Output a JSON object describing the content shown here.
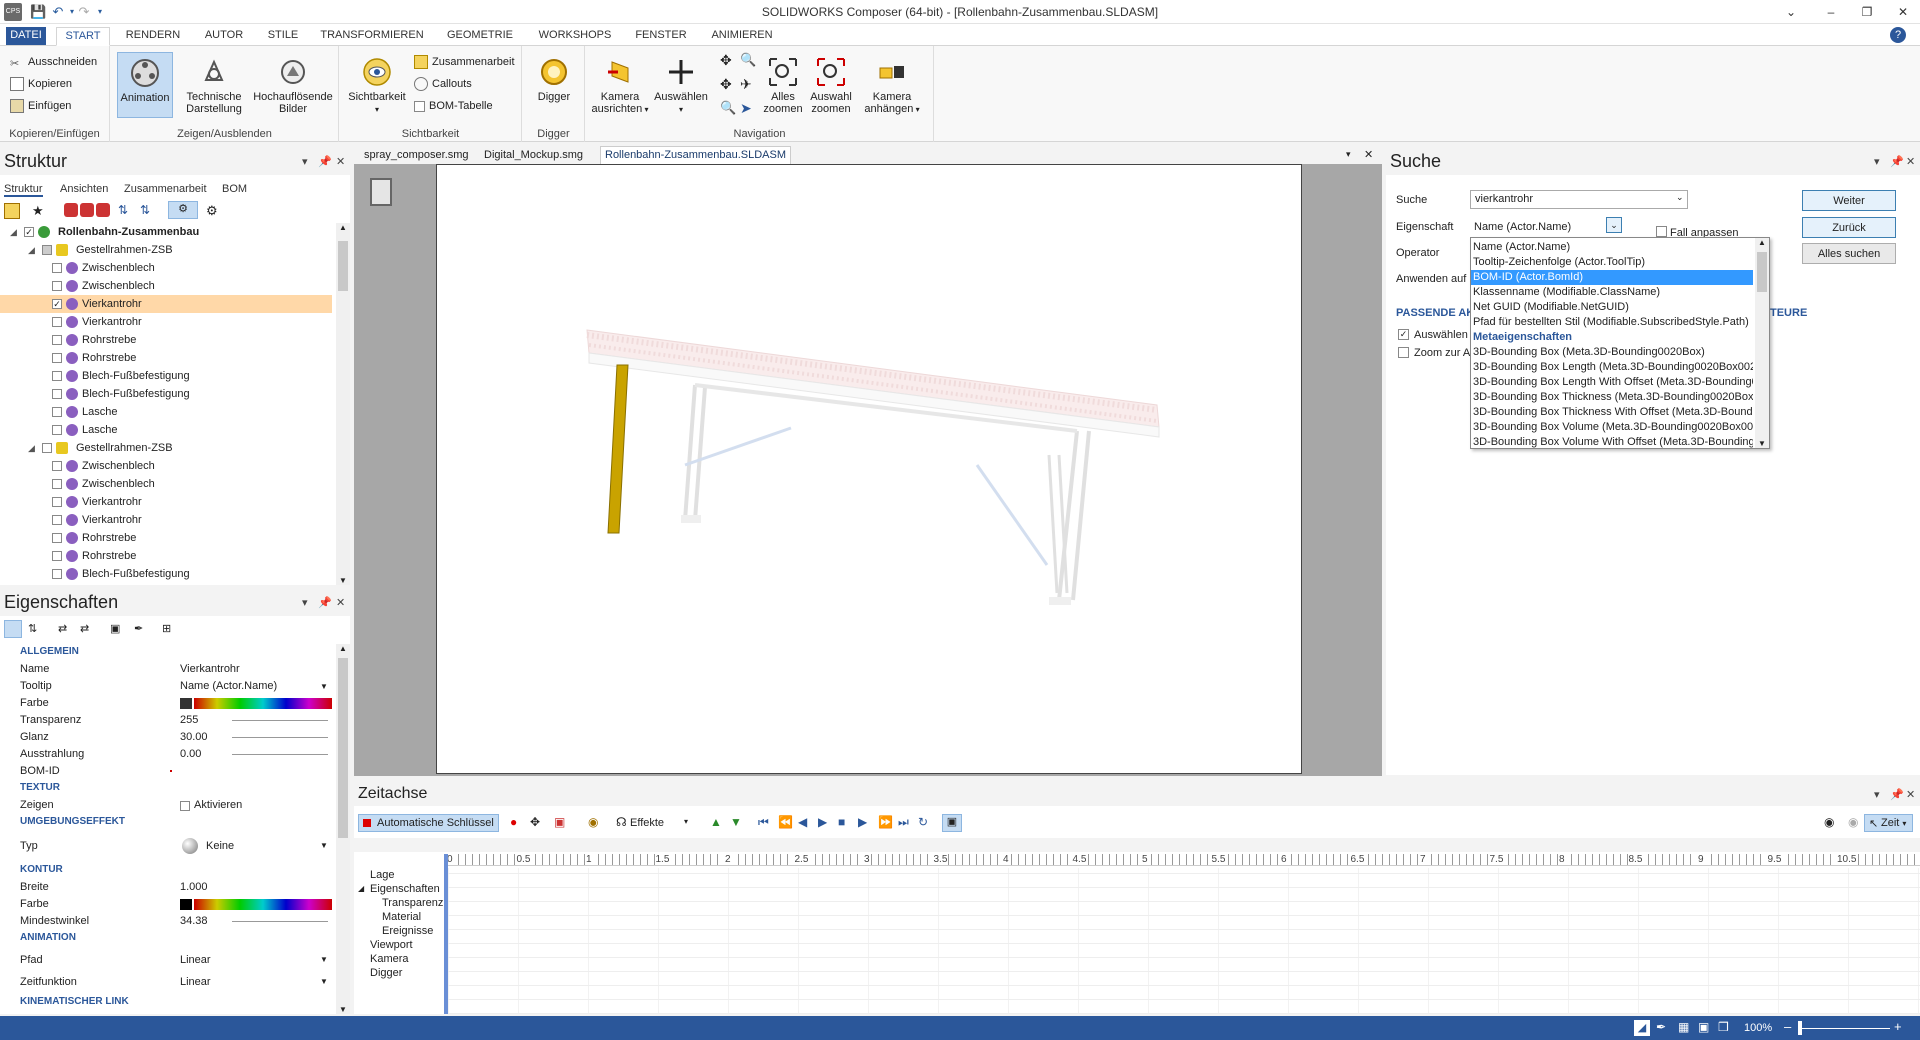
{
  "window": {
    "title": "SOLIDWORKS Composer (64-bit) - [Rollenbahn-Zusammenbau.SLDASM]"
  },
  "tabs": [
    "DATEI",
    "START",
    "RENDERN",
    "AUTOR",
    "STILE",
    "TRANSFORMIEREN",
    "GEOMETRIE",
    "WORKSHOPS",
    "FENSTER",
    "ANIMIEREN"
  ],
  "ribbon": {
    "clipboard": {
      "cut": "Ausschneiden",
      "copy": "Kopieren",
      "paste": "Einfügen",
      "group": "Kopieren/Einfügen"
    },
    "show": {
      "animation": "Animation",
      "technical_1": "Technische",
      "technical_2": "Darstellung",
      "hires_1": "Hochauflösende",
      "hires_2": "Bilder",
      "group": "Zeigen/Ausblenden"
    },
    "visibility": {
      "sichtbarkeit": "Sichtbarkeit",
      "zusammenarbeit": "Zusammenarbeit",
      "callouts": "Callouts",
      "bom": "BOM-Tabelle",
      "group": "Sichtbarkeit"
    },
    "digger": {
      "label": "Digger",
      "group": "Digger"
    },
    "navigation": {
      "camera_1": "Kamera",
      "camera_2": "ausrichten",
      "select": "Auswählen",
      "zoom_all_1": "Alles",
      "zoom_all_2": "zoomen",
      "zoom_sel_1": "Auswahl",
      "zoom_sel_2": "zoomen",
      "attach_1": "Kamera",
      "attach_2": "anhängen",
      "group": "Navigation"
    }
  },
  "structure": {
    "title": "Struktur",
    "subtabs": [
      "Struktur",
      "Ansichten",
      "Zusammenarbeit",
      "BOM"
    ],
    "root": "Rollenbahn-Zusammenbau",
    "group1": "Gestellrahmen-ZSB",
    "group1_items": [
      "Zwischenblech",
      "Zwischenblech",
      "Vierkantrohr",
      "Vierkantrohr",
      "Rohrstrebe",
      "Rohrstrebe",
      "Blech-Fußbefestigung",
      "Blech-Fußbefestigung",
      "Lasche",
      "Lasche"
    ],
    "group2": "Gestellrahmen-ZSB",
    "group2_items": [
      "Zwischenblech",
      "Zwischenblech",
      "Vierkantrohr",
      "Vierkantrohr",
      "Rohrstrebe",
      "Rohrstrebe",
      "Blech-Fußbefestigung"
    ]
  },
  "properties": {
    "title": "Eigenschaften",
    "sec_allgemein": "ALLGEMEIN",
    "name_label": "Name",
    "name_value": "Vierkantrohr",
    "tooltip_label": "Tooltip",
    "tooltip_value": "Name (Actor.Name)",
    "farbe_label": "Farbe",
    "transparenz_label": "Transparenz",
    "transparenz_value": "255",
    "glanz_label": "Glanz",
    "glanz_value": "30.00",
    "ausstrahlung_label": "Ausstrahlung",
    "ausstrahlung_value": "0.00",
    "bomid_label": "BOM-ID",
    "sec_textur": "TEXTUR",
    "zeigen_label": "Zeigen",
    "zeigen_value": "Aktivieren",
    "sec_umgebung": "UMGEBUNGSEFFEKT",
    "typ_label": "Typ",
    "typ_value": "Keine",
    "sec_kontur": "KONTUR",
    "breite_label": "Breite",
    "breite_value": "1.000",
    "farbe2_label": "Farbe",
    "mindest_label": "Mindestwinkel",
    "mindest_value": "34.38",
    "sec_animation": "ANIMATION",
    "pfad_label": "Pfad",
    "pfad_value": "Linear",
    "zeitfunktion_label": "Zeitfunktion",
    "zeitfunktion_value": "Linear",
    "sec_kinematik": "KINEMATISCHER LINK"
  },
  "doctabs": [
    "spray_composer.smg",
    "Digital_Mockup.smg",
    "Rollenbahn-Zusammenbau.SLDASM"
  ],
  "search": {
    "title": "Suche",
    "suche_label": "Suche",
    "suche_value": "vierkantrohr",
    "eigenschaft_label": "Eigenschaft",
    "eigenschaft_value": "Name (Actor.Name)",
    "fall": "Fall anpassen",
    "operator_label": "Operator",
    "anwenden_label": "Anwenden auf",
    "passende": "PASSENDE AK",
    "teure": "TEURE",
    "auswaehlen": "Auswählen",
    "zoom": "Zoom zur Au",
    "btn_weiter": "Weiter",
    "btn_zurueck": "Zurück",
    "btn_alle": "Alles suchen",
    "dropdown": [
      "Name (Actor.Name)",
      "Tooltip-Zeichenfolge (Actor.ToolTip)",
      "BOM-ID (Actor.BomId)",
      "Klassenname (Modifiable.ClassName)",
      "Net GUID (Modifiable.NetGUID)",
      "Pfad für bestellten Stil (Modifiable.SubscribedStyle.Path)",
      "Metaeigenschaften",
      "3D-Bounding Box (Meta.3D-Bounding0020Box)",
      "3D-Bounding Box Length (Meta.3D-Bounding0020Box0020",
      "3D-Bounding Box Length With Offset (Meta.3D-Bounding0",
      "3D-Bounding Box Thickness (Meta.3D-Bounding0020Box00",
      "3D-Bounding Box Thickness With Offset (Meta.3D-Boundin",
      "3D-Bounding Box Volume (Meta.3D-Bounding0020Box0020",
      "3D-Bounding Box Volume With Offset (Meta.3D-Bounding0"
    ],
    "dropdown_selected": 2
  },
  "timeline": {
    "title": "Zeitachse",
    "auto_key": "Automatische Schlüssel",
    "effekte": "Effekte",
    "zeit": "Zeit",
    "ticks": [
      "0",
      "0.5",
      "1",
      "1.5",
      "2",
      "2.5",
      "3",
      "3.5",
      "4",
      "4.5",
      "5",
      "5.5",
      "6",
      "6.5",
      "7",
      "7.5",
      "8",
      "8.5",
      "9",
      "9.5",
      "10.5"
    ],
    "tracks": [
      "Lage",
      "Eigenschaften",
      "Transparenz",
      "Material",
      "Ereignisse",
      "Viewport",
      "Kamera",
      "Digger"
    ]
  },
  "status": {
    "zoom": "100%"
  },
  "colors": {
    "accent": "#2b579a",
    "selection": "#ffd8a8",
    "highlight": "#c9a300"
  }
}
